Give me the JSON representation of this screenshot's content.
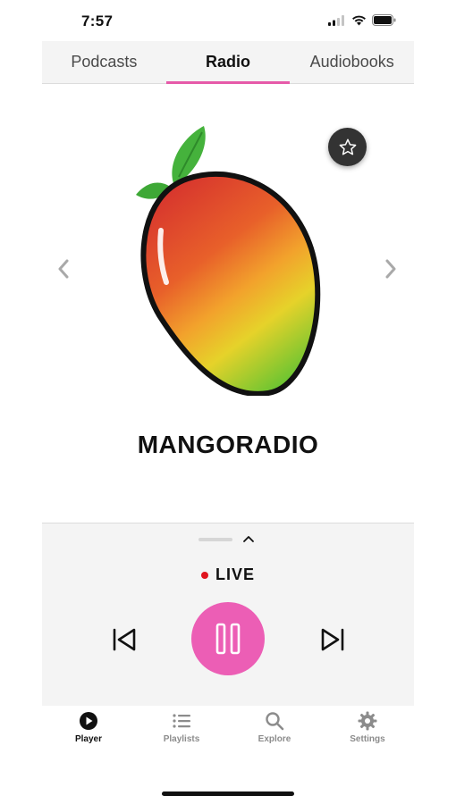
{
  "status_bar": {
    "time": "7:57"
  },
  "tabs": [
    {
      "label": "Podcasts",
      "active": false
    },
    {
      "label": "Radio",
      "active": true
    },
    {
      "label": "Audiobooks",
      "active": false
    }
  ],
  "station": {
    "name": "MANGORADIO",
    "favorite": false,
    "artwork_icon": "mango-logo"
  },
  "player": {
    "status": "LIVE",
    "is_playing": true
  },
  "bottom_nav": [
    {
      "label": "Player",
      "icon": "play-circle-icon",
      "active": true
    },
    {
      "label": "Playlists",
      "icon": "list-icon",
      "active": false
    },
    {
      "label": "Explore",
      "icon": "search-icon",
      "active": false
    },
    {
      "label": "Settings",
      "icon": "gear-icon",
      "active": false
    }
  ],
  "colors": {
    "accent": "#ec5eb5",
    "tab_indicator": "#e65aa9",
    "live_dot": "#e0141e",
    "panel_bg": "#f4f4f4"
  }
}
